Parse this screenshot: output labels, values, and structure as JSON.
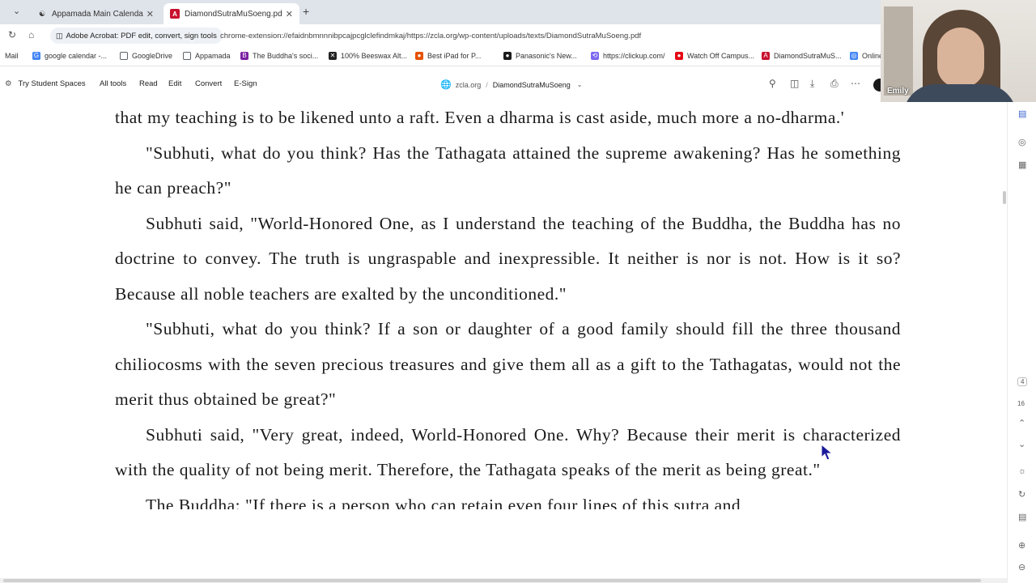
{
  "tabs": [
    {
      "title": "Appamada Main Calendar -- ...",
      "active": false,
      "icon": "appamada-icon"
    },
    {
      "title": "DiamondSutraMuSoeng.pdf",
      "active": true,
      "icon": "pdf-icon"
    }
  ],
  "address": {
    "site_chip": "Adobe Acrobat: PDF edit, convert, sign tools",
    "url": "chrome-extension://efaidnbmnnnibpcajpcglclefindmkaj/https://zcla.org/wp-content/uploads/texts/DiamondSutraMuSoeng.pdf"
  },
  "bookmarks": [
    {
      "label": "Mail",
      "icon": "mail-icon",
      "color": "#d93025"
    },
    {
      "label": "google calendar -...",
      "icon": "google-icon",
      "color": "#4285f4"
    },
    {
      "label": "GoogleDrive",
      "icon": "folder-icon",
      "color": "#5f6368"
    },
    {
      "label": "Appamada",
      "icon": "folder-icon",
      "color": "#5f6368"
    },
    {
      "label": "The Buddha's soci...",
      "icon": "book-icon",
      "color": "#7b1fa2"
    },
    {
      "label": "100% Beeswax Alt...",
      "icon": "candle-icon",
      "color": "#222222"
    },
    {
      "label": "Best iPad for P...",
      "icon": "site-icon",
      "color": "#e65100"
    },
    {
      "label": "Panasonic's New...",
      "icon": "site-icon",
      "color": "#1a1a1a"
    },
    {
      "label": "https://clickup.com/",
      "icon": "clickup-icon",
      "color": "#7b68ee"
    },
    {
      "label": "Watch Off Campus...",
      "icon": "site-icon",
      "color": "#e50914"
    },
    {
      "label": "DiamondSutraMuS...",
      "icon": "pdf-icon",
      "color": "#c8102e"
    },
    {
      "label": "Online",
      "icon": "globe-icon",
      "color": "#4285f4"
    }
  ],
  "toolbar": {
    "student": "Try Student Spaces",
    "all_tools": "All tools",
    "read": "Read",
    "edit": "Edit",
    "convert": "Convert",
    "esign": "E-Sign",
    "domain": "zcla.org",
    "separator": "/",
    "doc_name": "DiamondSutraMuSoeng"
  },
  "document": {
    "paragraphs": [
      "that my teaching is to be likened unto a raft. Even a dharma is cast aside, much more a no-dharma.'",
      "\"Subhuti, what do you think? Has the Tathagata attained the supreme awakening? Has he something he can preach?\"",
      "Subhuti said, \"World-Honored One, as I understand the teaching of the Buddha, the Buddha has no doctrine to convey. The truth is ungraspable and inexpressible. It neither is nor is not. How is it so? Because all noble teachers are exalted by the unconditioned.\"",
      "\"Subhuti, what do you think? If a son or daughter of a good family should fill the three thousand chiliocosms with the seven precious treasures and give them all as a gift to the Tathagatas, would not the merit thus obtained be great?\"",
      "Subhuti said, \"Very great, indeed, World-Honored One. Why? Because their merit is characterized with the quality of not being merit. Therefore, the Tathagata speaks of the merit as being great.\"",
      "The Buddha: \"If there is a person who can retain even four lines of this sutra and"
    ]
  },
  "page_nav": {
    "current_page": "4",
    "total_pages": "16"
  },
  "webcam": {
    "name": "Emily"
  }
}
